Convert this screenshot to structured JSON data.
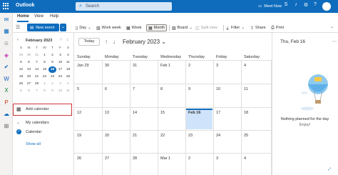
{
  "app": {
    "name": "Outlook"
  },
  "search": {
    "placeholder": "Search"
  },
  "topbar": {
    "meet_now": "Meet Now",
    "avatar": ""
  },
  "tabs": [
    "Home",
    "View",
    "Help"
  ],
  "ribbon": {
    "new_event": "New event",
    "day": "Day",
    "work_week": "Work week",
    "week": "Week",
    "month": "Month",
    "board": "Board",
    "split_view": "Split view",
    "filter": "Filter",
    "share": "Share",
    "print": "Print"
  },
  "mini_calendar": {
    "title": "February 2023",
    "weekday_headers": [
      "S",
      "M",
      "T",
      "W",
      "T",
      "F",
      "S"
    ],
    "weeks": [
      [
        "29",
        "30",
        "31",
        "1",
        "2",
        "3",
        "4"
      ],
      [
        "5",
        "6",
        "7",
        "8",
        "9",
        "10",
        "11"
      ],
      [
        "12",
        "13",
        "14",
        "15",
        "16",
        "17",
        "18"
      ],
      [
        "19",
        "20",
        "21",
        "22",
        "23",
        "24",
        "25"
      ],
      [
        "26",
        "27",
        "28",
        "1",
        "2",
        "3",
        "4"
      ],
      [
        "5",
        "6",
        "7",
        "8",
        "9",
        "10",
        "11"
      ]
    ],
    "selected": "16"
  },
  "left_pane": {
    "add_calendar": "Add calendar",
    "my_calendars": "My calendars",
    "calendar": "Calendar",
    "show_all": "Show all"
  },
  "calendar": {
    "today_button": "Today",
    "title": "February 2023",
    "days": [
      "Sunday",
      "Monday",
      "Tuesday",
      "Wednesday",
      "Thursday",
      "Friday",
      "Saturday"
    ],
    "weeks": [
      [
        "Jan 29",
        "30",
        "31",
        "Feb 1",
        "2",
        "3",
        "4"
      ],
      [
        "5",
        "6",
        "7",
        "8",
        "9",
        "10",
        "11"
      ],
      [
        "12",
        "13",
        "14",
        "15",
        "Feb 16",
        "17",
        "18"
      ],
      [
        "19",
        "20",
        "21",
        "22",
        "23",
        "24",
        "25"
      ],
      [
        "26",
        "27",
        "28",
        "Mar 1",
        "2",
        "3",
        "4"
      ]
    ]
  },
  "right_pane": {
    "title": "Thu, Feb 16",
    "nothing": "Nothing planned for the day",
    "enjoy": "Enjoy!"
  }
}
